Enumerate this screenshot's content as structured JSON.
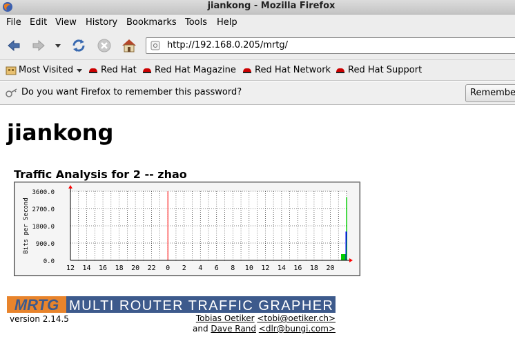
{
  "window": {
    "title": "jiankong - Mozilla Firefox"
  },
  "menu": [
    "File",
    "Edit",
    "View",
    "History",
    "Bookmarks",
    "Tools",
    "Help"
  ],
  "navigation": {
    "url": "http://192.168.0.205/mrtg/"
  },
  "bookmarks": {
    "most_visited": "Most Visited",
    "items": [
      "Red Hat",
      "Red Hat Magazine",
      "Red Hat Network",
      "Red Hat Support"
    ]
  },
  "notification": {
    "message": "Do you want Firefox to remember this password?",
    "button": "Remember"
  },
  "page": {
    "heading": "jiankong",
    "graph_title": "Traffic Analysis for 2 -- zhao",
    "banner_logo": "MRTG",
    "banner_text": "MULTI ROUTER TRAFFIC GRAPHER",
    "version": "version 2.14.5",
    "credit_author1": "Tobias Oetiker",
    "credit_email1": "<tobi@oetiker.ch>",
    "credit_and": "and",
    "credit_author2": "Dave Rand",
    "credit_email2": "<dlr@bungi.com>"
  },
  "chart_data": {
    "type": "area",
    "ylabel": "Bits per Second",
    "ylim": [
      0,
      3600
    ],
    "y_ticks": [
      "3600.0",
      "2700.0",
      "1800.0",
      "900.0",
      "0.0"
    ],
    "x_tick_labels": [
      "12",
      "14",
      "16",
      "18",
      "20",
      "22",
      "0",
      "2",
      "4",
      "6",
      "8",
      "10",
      "12",
      "14",
      "16",
      "18",
      "20"
    ],
    "midnight_marker": "0",
    "grid": true,
    "series": [
      {
        "values": [
          0,
          0,
          0,
          0,
          0,
          0,
          0,
          0,
          0,
          0,
          0,
          0,
          0,
          0,
          0,
          0,
          0,
          0,
          0,
          3300
        ]
      },
      {
        "values": [
          0,
          0,
          0,
          0,
          0,
          0,
          0,
          0,
          0,
          0,
          0,
          0,
          0,
          0,
          0,
          0,
          0,
          0,
          0,
          1500
        ]
      }
    ],
    "colors": {
      "incoming": "#00cc00",
      "outgoing": "#0000ff",
      "midnight": "#ff0000"
    }
  }
}
